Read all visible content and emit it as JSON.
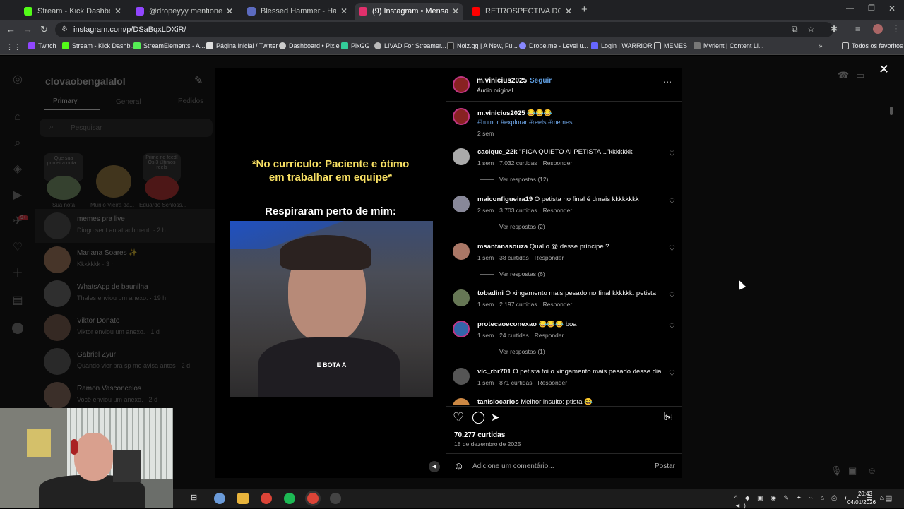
{
  "browser": {
    "tabs": [
      {
        "label": "Stream - Kick Dashboard",
        "color": "#53fc18",
        "active": false
      },
      {
        "label": "@dropeyyy mentioned you",
        "color": "#9146ff",
        "active": false
      },
      {
        "label": "Blessed Hammer - Hammerkun",
        "color": "#5c6bc0",
        "active": false
      },
      {
        "label": "(9) Instagram • Mensagens",
        "color": "#e1306c",
        "active": true
      },
      {
        "label": "RETROSPECTIVA DO FUTEBOL",
        "color": "#ff0000",
        "active": false
      }
    ],
    "url": "instagram.com/p/DSaBqxLDXiR/",
    "bookmarks": [
      "Twitch",
      "Stream - Kick Dashb...",
      "StreamElements - A...",
      "Página Inicial / Twitter",
      "Dashboard • Pixie",
      "PixGG",
      "LIVAD For Streamer...",
      "Noiz.gg | A New, Fu...",
      "Drope.me - Level u...",
      "Login | WARRIOR",
      "MEMES",
      "Myrient | Content Li...",
      "Todos os favoritos"
    ]
  },
  "dm": {
    "username": "clovaobengalalol",
    "tabs": [
      "Primary",
      "General",
      "Pedidos"
    ],
    "search_placeholder": "Pesquisar",
    "notes": [
      {
        "bubble": "Que sua primeira nota...",
        "name": "Sua nota"
      },
      {
        "bubble": "",
        "name": "Murilo Vieira da..."
      },
      {
        "bubble": "Prime no feed! Os 3 últimos reels",
        "name": "Eduardo Schloss..."
      }
    ],
    "threads": [
      {
        "name": "memes pra live",
        "preview": "Diogo sent an attachment. · 2 h"
      },
      {
        "name": "Mariana Soares ✨",
        "preview": "Kkkkkkk · 3 h"
      },
      {
        "name": "WhatsApp de baunilha",
        "preview": "Thales enviou um anexo. · 19 h"
      },
      {
        "name": "Viktor Donato",
        "preview": "Viktor enviou um anexo. · 1 d"
      },
      {
        "name": "Gabriel Zyur",
        "preview": "Quando vier pra sp me avisa antes · 2 d"
      },
      {
        "name": "Ramon Vasconcelos",
        "preview": "Você enviou um anexo. · 2 d"
      }
    ],
    "notif_count": "9+"
  },
  "post": {
    "video": {
      "caption_top": "*No currículo: Paciente e ótimo em trabalhar em equipe*",
      "caption_mid": "Respiraram perto de mim:",
      "subtitle": "E BOTA A"
    },
    "author": "m.vinicius2025",
    "follow_label": "Seguir",
    "audio": "Áudio original",
    "caption_emojis": "😂😂😂",
    "hashtags": "#humor #explorar #reels #memes",
    "caption_time": "2 sem",
    "comments": [
      {
        "user": "cacique_22k",
        "text": "\"FICA QUIETO AI PETISTA...\"kkkkkkk",
        "time": "1 sem",
        "likes": "7.032 curtidas",
        "reply": "Responder",
        "replies": "Ver respostas (12)"
      },
      {
        "user": "maiconfigueira19",
        "text": "O petista no final é dmais kkkkkkkk",
        "time": "2 sem",
        "likes": "3.703 curtidas",
        "reply": "Responder",
        "replies": "Ver respostas (2)"
      },
      {
        "user": "msantanasouza",
        "text": "Qual o @ desse príncipe ?",
        "time": "1 sem",
        "likes": "38 curtidas",
        "reply": "Responder",
        "replies": "Ver respostas (6)"
      },
      {
        "user": "tobadini",
        "text": "O xingamento mais pesado no final kkkkkk: petista",
        "time": "1 sem",
        "likes": "2.197 curtidas",
        "reply": "Responder",
        "replies": ""
      },
      {
        "user": "protecaoeconexao",
        "text": "😂😂😂 boa",
        "time": "1 sem",
        "likes": "24 curtidas",
        "reply": "Responder",
        "replies": "Ver respostas (1)"
      },
      {
        "user": "vic_rbr701",
        "text": "O petista foi o xingamento mais pesado desse dia",
        "time": "1 sem",
        "likes": "871 curtidas",
        "reply": "Responder",
        "replies": ""
      },
      {
        "user": "tanisiocarlos",
        "text": "Melhor insulto: ptista 😂",
        "time": "",
        "likes": "",
        "reply": "",
        "replies": ""
      }
    ],
    "likes": "70.277 curtidas",
    "date": "18 de dezembro de 2025",
    "comment_placeholder": "Adicione um comentário...",
    "post_label": "Postar"
  },
  "taskbar": {
    "time": "20:43",
    "date": "04/01/2026"
  },
  "colors": {
    "accent": "#0095f6",
    "bg": "#000000",
    "dim_bg": "#0a0a0a"
  }
}
